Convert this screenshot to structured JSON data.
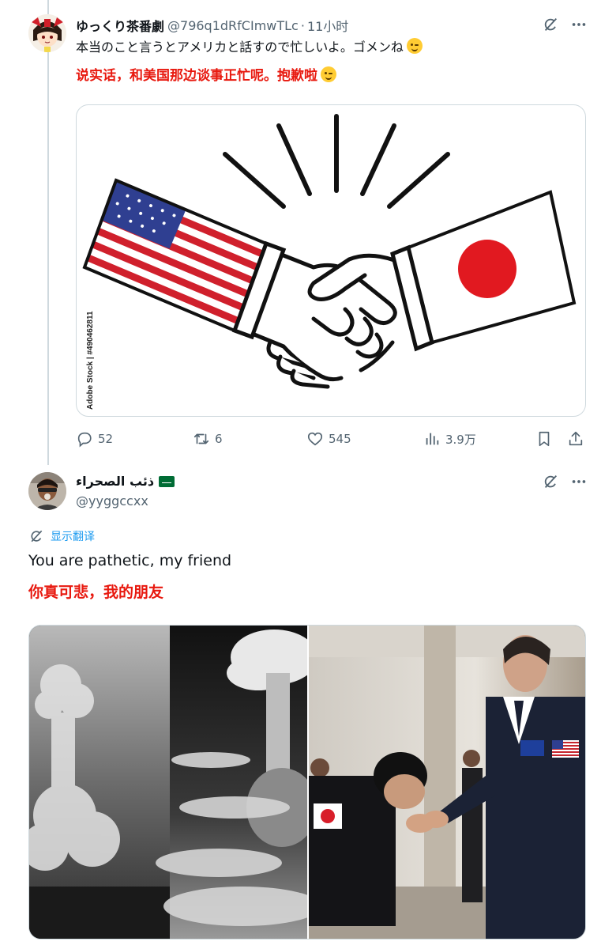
{
  "tweet1": {
    "display_name": "ゆっくり茶番劇",
    "handle": "@796q1dRfCImwTLc",
    "separator": "·",
    "time": "11小时",
    "text": "本当のこと言うとアメリカと話すので忙しいよ。ゴメンね",
    "translation": "说实话，和美国那边谈事正忙呢。抱歉啦",
    "image_watermark": "Adobe Stock | #490462811",
    "stats": {
      "replies": "52",
      "retweets": "6",
      "likes": "545",
      "views": "3.9万"
    },
    "icons": [
      "grok-icon",
      "more-icon",
      "reply-icon",
      "retweet-icon",
      "like-icon",
      "views-icon",
      "bookmark-icon",
      "share-icon"
    ]
  },
  "tweet2": {
    "display_name": "ذئب الصحراء",
    "handle": "@yyggccxx",
    "translate_label": "显示翻译",
    "text": "You are pathetic, my friend",
    "translation": "你真可悲，我的朋友",
    "icons": [
      "grok-icon",
      "more-icon",
      "translate-icon"
    ]
  },
  "colors": {
    "translation_red": "#e8190f",
    "link_blue": "#1d9bf0",
    "muted_gray": "#536471",
    "divider": "#cfd9de"
  }
}
